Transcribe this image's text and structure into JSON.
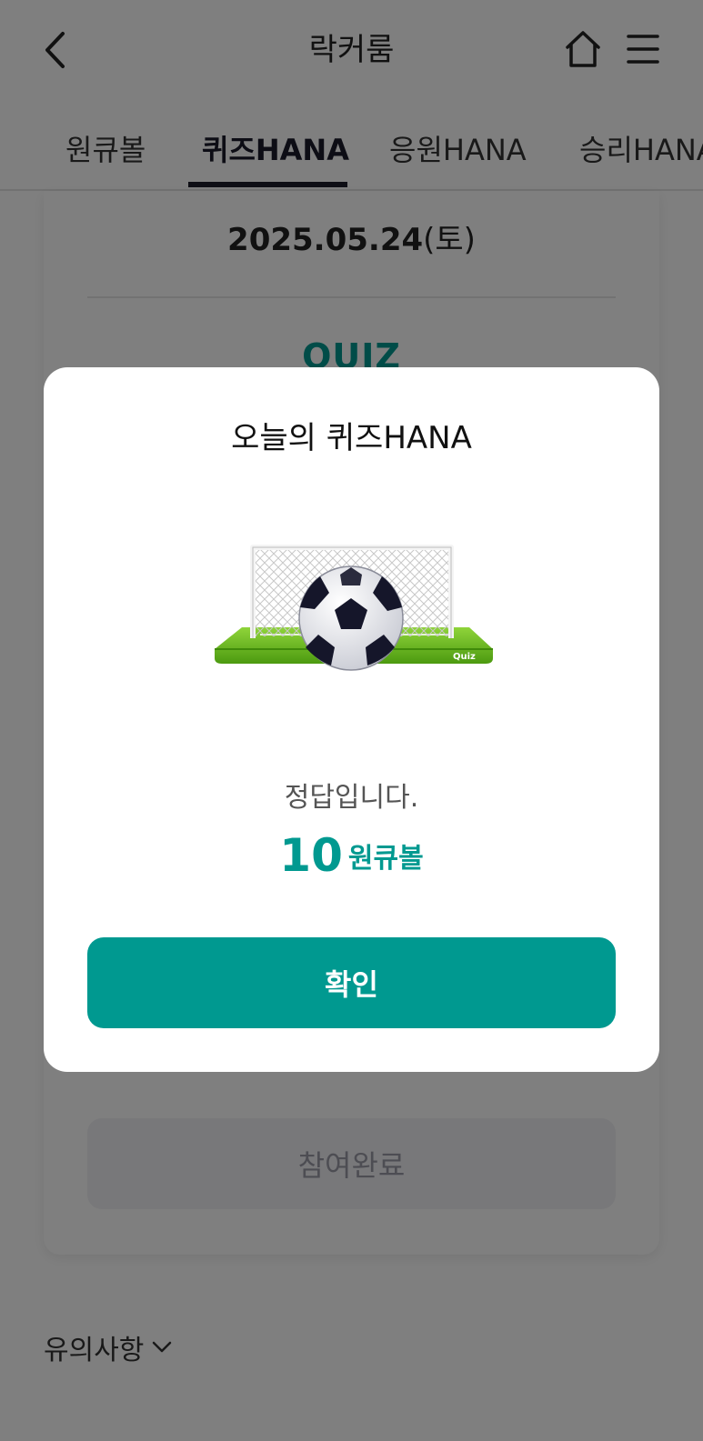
{
  "header": {
    "title": "락커룸",
    "back_icon": "chevron-left-icon",
    "home_icon": "home-icon",
    "menu_icon": "hamburger-menu-icon"
  },
  "tabs": [
    {
      "label": "원큐볼",
      "active": false
    },
    {
      "label": "퀴즈HANA",
      "active": true
    },
    {
      "label": "응원HANA",
      "active": false
    },
    {
      "label": "승리HANA",
      "active": false
    }
  ],
  "quiz_card": {
    "date": "2025.05.24",
    "day_of_week": "(토)",
    "section_label": "QUIZ",
    "done_button_label": "참여완료"
  },
  "notice": {
    "label": "유의사항",
    "icon": "chevron-down-icon"
  },
  "modal": {
    "title": "오늘의 퀴즈HANA",
    "image_icon": "soccer-goal-ball-icon",
    "image_badge": "Quiz",
    "message": "정답입니다.",
    "reward_amount": "10",
    "reward_unit": "원큐볼",
    "confirm_label": "확인"
  },
  "colors": {
    "accent": "#009990",
    "overlay": "rgba(0,0,0,0.5)",
    "tab_indicator": "#1d1d2b",
    "disabled_button": "#f0f1f5"
  }
}
